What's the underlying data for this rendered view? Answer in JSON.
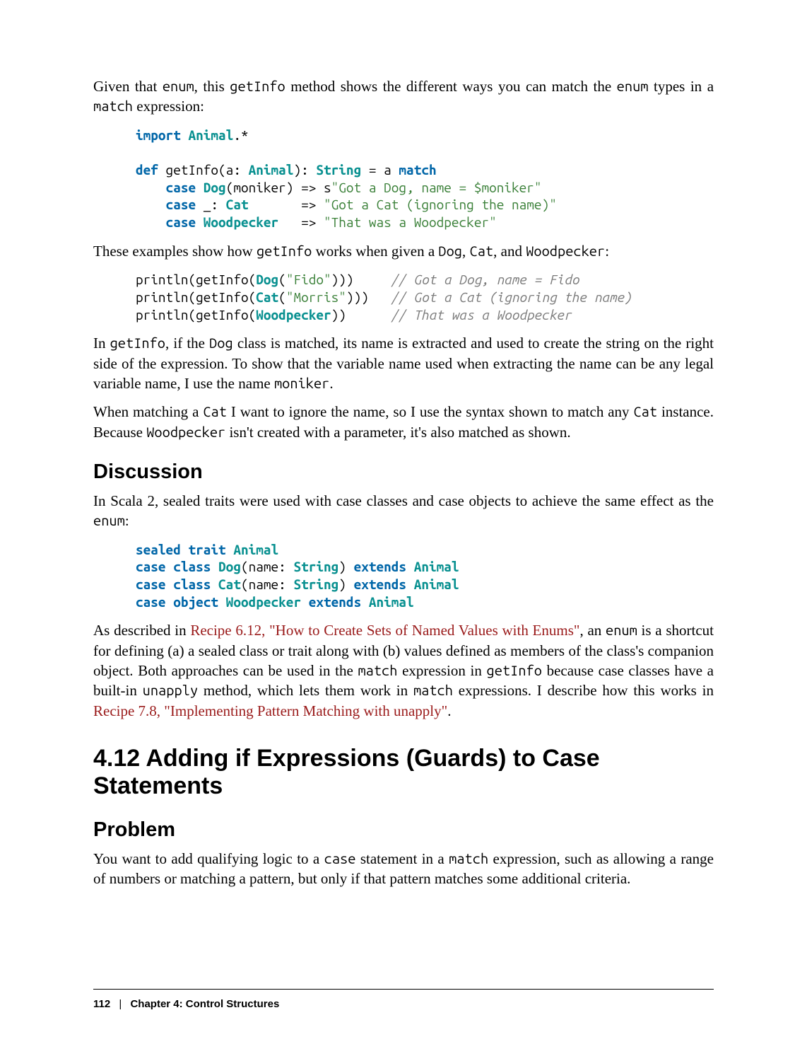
{
  "p1_a": "Given that ",
  "p1_code1": "enum",
  "p1_b": ", this ",
  "p1_code2": "getInfo",
  "p1_c": " method shows the different ways you can match the ",
  "p1_code3": "enum",
  "p1_d": " types in a ",
  "p1_code4": "match",
  "p1_e": " expression:",
  "code1": {
    "l1a": "import",
    "l1b": " Animal",
    "l1c": ".*",
    "l3a": "def",
    "l3b": " getInfo(a: ",
    "l3c": "Animal",
    "l3d": "): ",
    "l3e": "String",
    "l3f": " = a ",
    "l3g": "match",
    "l4a": "    case",
    "l4b": " Dog",
    "l4c": "(moniker) => s",
    "l4d": "\"Got a Dog, name = $moniker\"",
    "l5a": "    case",
    "l5b": " _: ",
    "l5c": "Cat",
    "l5d": "       => ",
    "l5e": "\"Got a Cat (ignoring the name)\"",
    "l6a": "    case",
    "l6b": " Woodpecker",
    "l6c": "   => ",
    "l6d": "\"That was a Woodpecker\""
  },
  "p2_a": "These examples show how ",
  "p2_code1": "getInfo",
  "p2_b": " works when given a ",
  "p2_code2": "Dog",
  "p2_c": ", ",
  "p2_code3": "Cat",
  "p2_d": ", and ",
  "p2_code4": "Woodpecker",
  "p2_e": ":",
  "code2": {
    "l1a": "println(getInfo(",
    "l1b": "Dog",
    "l1c": "(",
    "l1d": "\"Fido\"",
    "l1e": ")))     ",
    "l1f": "// Got a Dog, name = Fido",
    "l2a": "println(getInfo(",
    "l2b": "Cat",
    "l2c": "(",
    "l2d": "\"Morris\"",
    "l2e": ")))   ",
    "l2f": "// Got a Cat (ignoring the name)",
    "l3a": "println(getInfo(",
    "l3b": "Woodpecker",
    "l3c": "))      ",
    "l3f": "// That was a Woodpecker"
  },
  "p3_a": "In ",
  "p3_code1": "getInfo",
  "p3_b": ", if the ",
  "p3_code2": "Dog",
  "p3_c": " class is matched, its name is extracted and used to create the string on the right side of the expression. To show that the variable name used when extracting the name can be any legal variable name, I use the name ",
  "p3_code3": "moniker",
  "p3_d": ".",
  "p4_a": "When matching a ",
  "p4_code1": "Cat",
  "p4_b": " I want to ignore the name, so I use the syntax shown to match any ",
  "p4_code2": "Cat",
  "p4_c": " instance. Because ",
  "p4_code3": "Woodpecker",
  "p4_d": " isn't created with a parameter, it's also matched as shown.",
  "h_discussion": "Discussion",
  "p5_a": "In Scala 2, sealed traits were used with case classes and case objects to achieve the same effect as the ",
  "p5_code1": "enum",
  "p5_b": ":",
  "code3": {
    "l1a": "sealed",
    "l1b": " trait",
    "l1c": " Animal",
    "l2a": "case",
    "l2b": " class",
    "l2c": " Dog",
    "l2d": "(name: ",
    "l2e": "String",
    "l2f": ") ",
    "l2g": "extends",
    "l2h": " Animal",
    "l3a": "case",
    "l3b": " class",
    "l3c": " Cat",
    "l3d": "(name: ",
    "l3e": "String",
    "l3f": ") ",
    "l3g": "extends",
    "l3h": " Animal",
    "l4a": "case",
    "l4b": " object",
    "l4c": " Woodpecker",
    "l4d": " extends",
    "l4e": " Animal"
  },
  "p6_a": "As described in ",
  "p6_link1": "Recipe 6.12, \"How to Create Sets of Named Values with Enums\"",
  "p6_b": ", an ",
  "p6_code1": "enum",
  "p6_c": " is a shortcut for defining (a) a sealed class or trait along with (b) values defined as members of the class's companion object. Both approaches can be used in the ",
  "p6_code2": "match",
  "p6_d": " expression in ",
  "p6_code3": "getInfo",
  "p6_e": " because case classes have a built-in ",
  "p6_code4": "unapply",
  "p6_f": " method, which lets them work in ",
  "p6_code5": "match",
  "p6_g": " expressions. I describe how this works in ",
  "p6_link2": "Recipe 7.8, \"Implementing Pattern Matching with unapply\"",
  "p6_h": ".",
  "h_section": "4.12 Adding if Expressions (Guards) to Case Statements",
  "h_problem": "Problem",
  "p7_a": "You want to add qualifying logic to a ",
  "p7_code1": "case",
  "p7_b": " statement in a ",
  "p7_code2": "match",
  "p7_c": " expression, such as allowing a range of numbers or matching a pattern, but only if that pattern matches some additional criteria.",
  "footer": {
    "page": "112",
    "sep": "|",
    "chapter": "Chapter 4: Control Structures"
  }
}
